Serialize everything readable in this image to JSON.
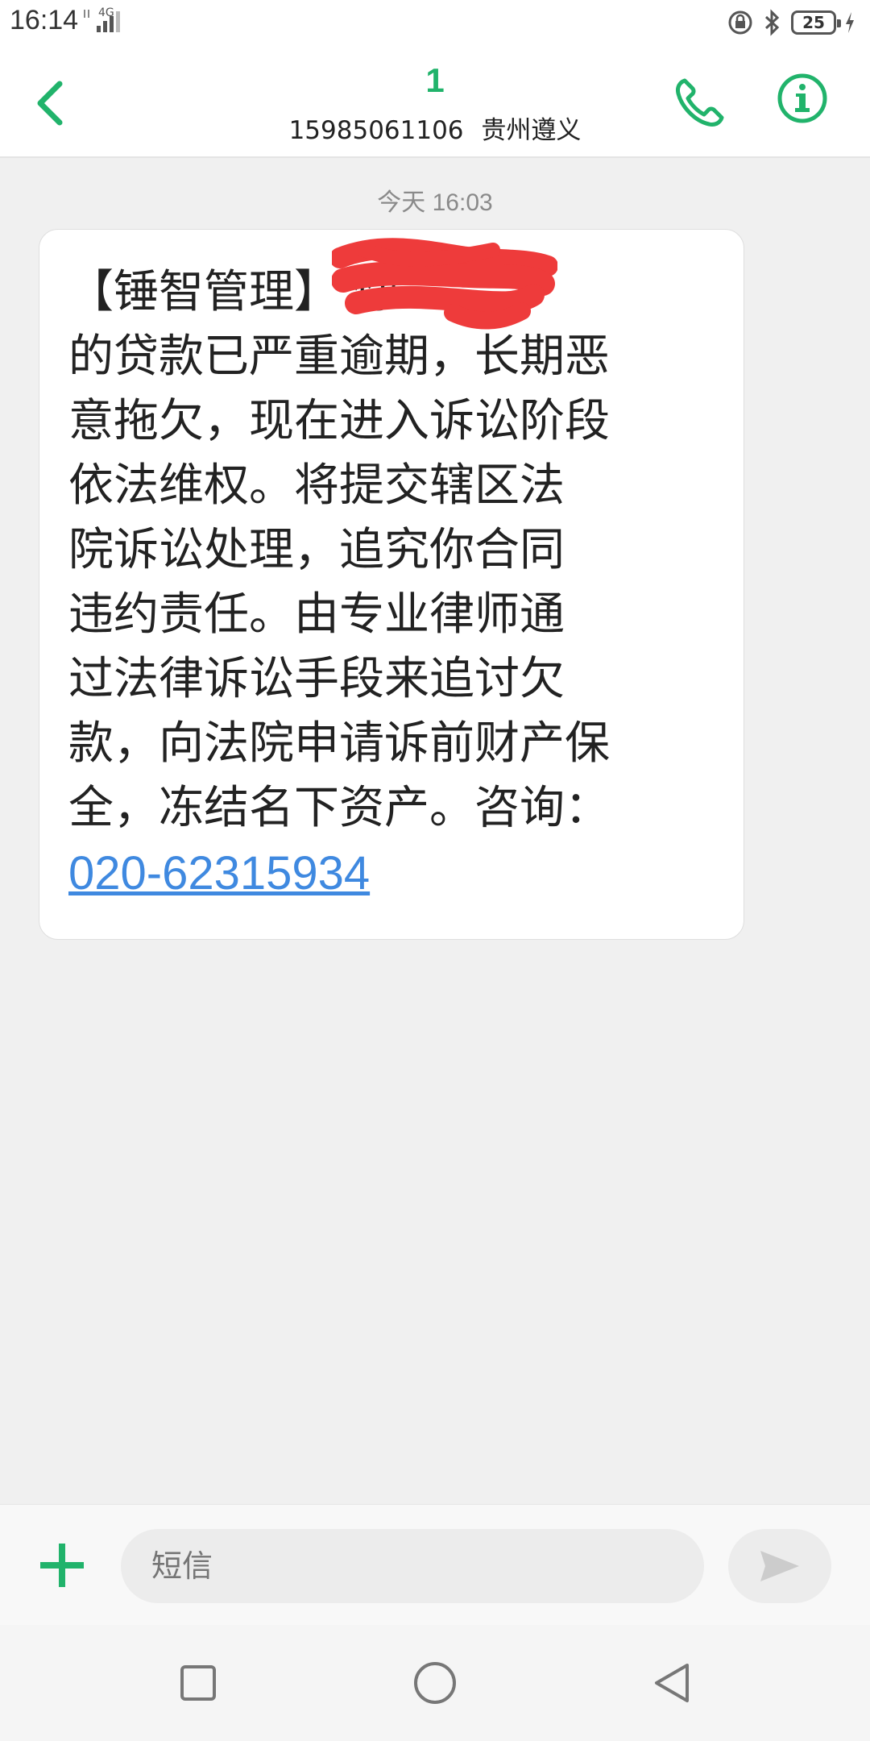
{
  "status_bar": {
    "time": "16:14",
    "network": "4G",
    "battery_level": "25"
  },
  "header": {
    "contact_name": "1",
    "phone_number": "15985061106",
    "location": "贵州遵义"
  },
  "conversation": {
    "timestamp": "今天 16:03",
    "message": {
      "body": "【锤智管理】            你\n的贷款已严重逾期，长期恶\n意拖欠，现在进入诉讼阶段\n依法维权。将提交辖区法\n院诉讼处理，追究你合同\n违约责任。由专业律师通\n过法律诉讼手段来追讨欠\n款，向法院申请诉前财产保\n全，冻结名下资产。咨询：",
      "link": "020-62315934"
    }
  },
  "composer": {
    "placeholder": "短信"
  },
  "colors": {
    "accent": "#21b36b",
    "link": "#3f89e0",
    "redaction": "#ee3b3b"
  }
}
